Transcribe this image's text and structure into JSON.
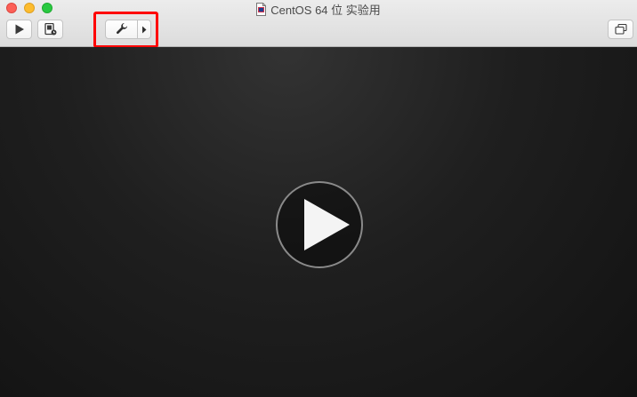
{
  "window": {
    "title": "CentOS 64 位 实验用"
  },
  "toolbar": {
    "play_icon": "play-icon",
    "snapshot_icon": "snapshot-icon",
    "settings_icon": "wrench-icon",
    "settings_menu_icon": "chevron-right-icon",
    "restore_icon": "restore-window-icon"
  },
  "annotation": {
    "highlight_color": "#ff0000"
  },
  "viewport": {
    "center_icon": "play-icon"
  }
}
